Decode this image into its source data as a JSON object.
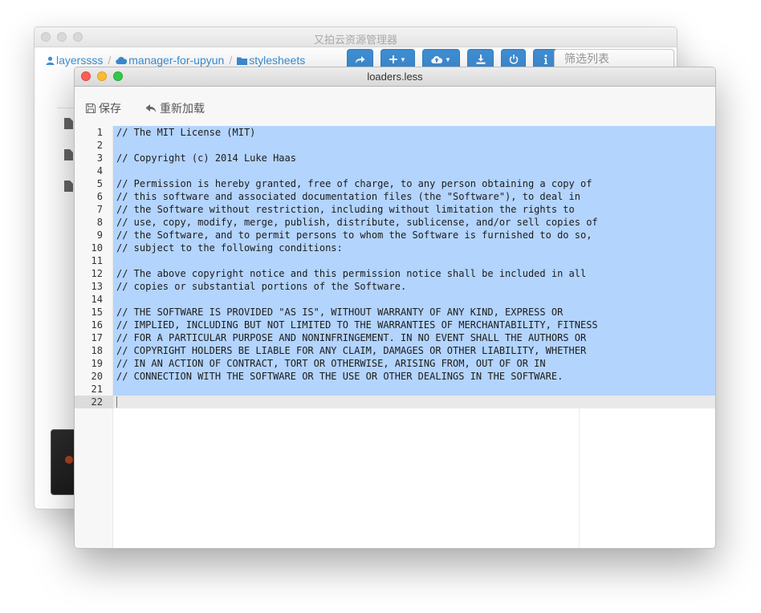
{
  "back_window": {
    "title": "又拍云资源管理器",
    "breadcrumb": [
      "layerssss",
      "manager-for-upyun",
      "stylesheets"
    ],
    "breadcrumb_separator": "/",
    "toolbar_buttons": [
      {
        "name": "share",
        "icon": "share-icon"
      },
      {
        "name": "new",
        "icon": "plus-icon",
        "dropdown": true
      },
      {
        "name": "upload",
        "icon": "cloud-upload-icon",
        "dropdown": true
      },
      {
        "name": "download",
        "icon": "download-icon"
      },
      {
        "name": "logout",
        "icon": "power-icon"
      },
      {
        "name": "info",
        "icon": "info-icon"
      }
    ],
    "filter_placeholder": "筛选列表",
    "accent_color": "#3f8fd5"
  },
  "front_window": {
    "title": "loaders.less",
    "toolbar": {
      "save_label": "保存",
      "reload_label": "重新加载"
    },
    "selection_color": "#b3d4fd",
    "active_line": 22,
    "lines": [
      {
        "n": "1",
        "t": "// The MIT License (MIT)"
      },
      {
        "n": "2",
        "t": ""
      },
      {
        "n": "3",
        "t": "// Copyright (c) 2014 Luke Haas"
      },
      {
        "n": "4",
        "t": ""
      },
      {
        "n": "5",
        "t": "// Permission is hereby granted, free of charge, to any person obtaining a copy of"
      },
      {
        "n": "6",
        "t": "// this software and associated documentation files (the \"Software\"), to deal in"
      },
      {
        "n": "7",
        "t": "// the Software without restriction, including without limitation the rights to"
      },
      {
        "n": "8",
        "t": "// use, copy, modify, merge, publish, distribute, sublicense, and/or sell copies of"
      },
      {
        "n": "9",
        "t": "// the Software, and to permit persons to whom the Software is furnished to do so,"
      },
      {
        "n": "10",
        "t": "// subject to the following conditions:"
      },
      {
        "n": "11",
        "t": ""
      },
      {
        "n": "12",
        "t": "// The above copyright notice and this permission notice shall be included in all"
      },
      {
        "n": "13",
        "t": "// copies or substantial portions of the Software."
      },
      {
        "n": "14",
        "t": ""
      },
      {
        "n": "15",
        "t": "// THE SOFTWARE IS PROVIDED \"AS IS\", WITHOUT WARRANTY OF ANY KIND, EXPRESS OR"
      },
      {
        "n": "16",
        "t": "// IMPLIED, INCLUDING BUT NOT LIMITED TO THE WARRANTIES OF MERCHANTABILITY, FITNESS"
      },
      {
        "n": "17",
        "t": "// FOR A PARTICULAR PURPOSE AND NONINFRINGEMENT. IN NO EVENT SHALL THE AUTHORS OR"
      },
      {
        "n": "18",
        "t": "// COPYRIGHT HOLDERS BE LIABLE FOR ANY CLAIM, DAMAGES OR OTHER LIABILITY, WHETHER"
      },
      {
        "n": "19",
        "t": "// IN AN ACTION OF CONTRACT, TORT OR OTHERWISE, ARISING FROM, OUT OF OR IN"
      },
      {
        "n": "20",
        "t": "// CONNECTION WITH THE SOFTWARE OR THE USE OR OTHER DEALINGS IN THE SOFTWARE."
      },
      {
        "n": "21",
        "t": ""
      },
      {
        "n": "22",
        "t": ""
      }
    ]
  }
}
